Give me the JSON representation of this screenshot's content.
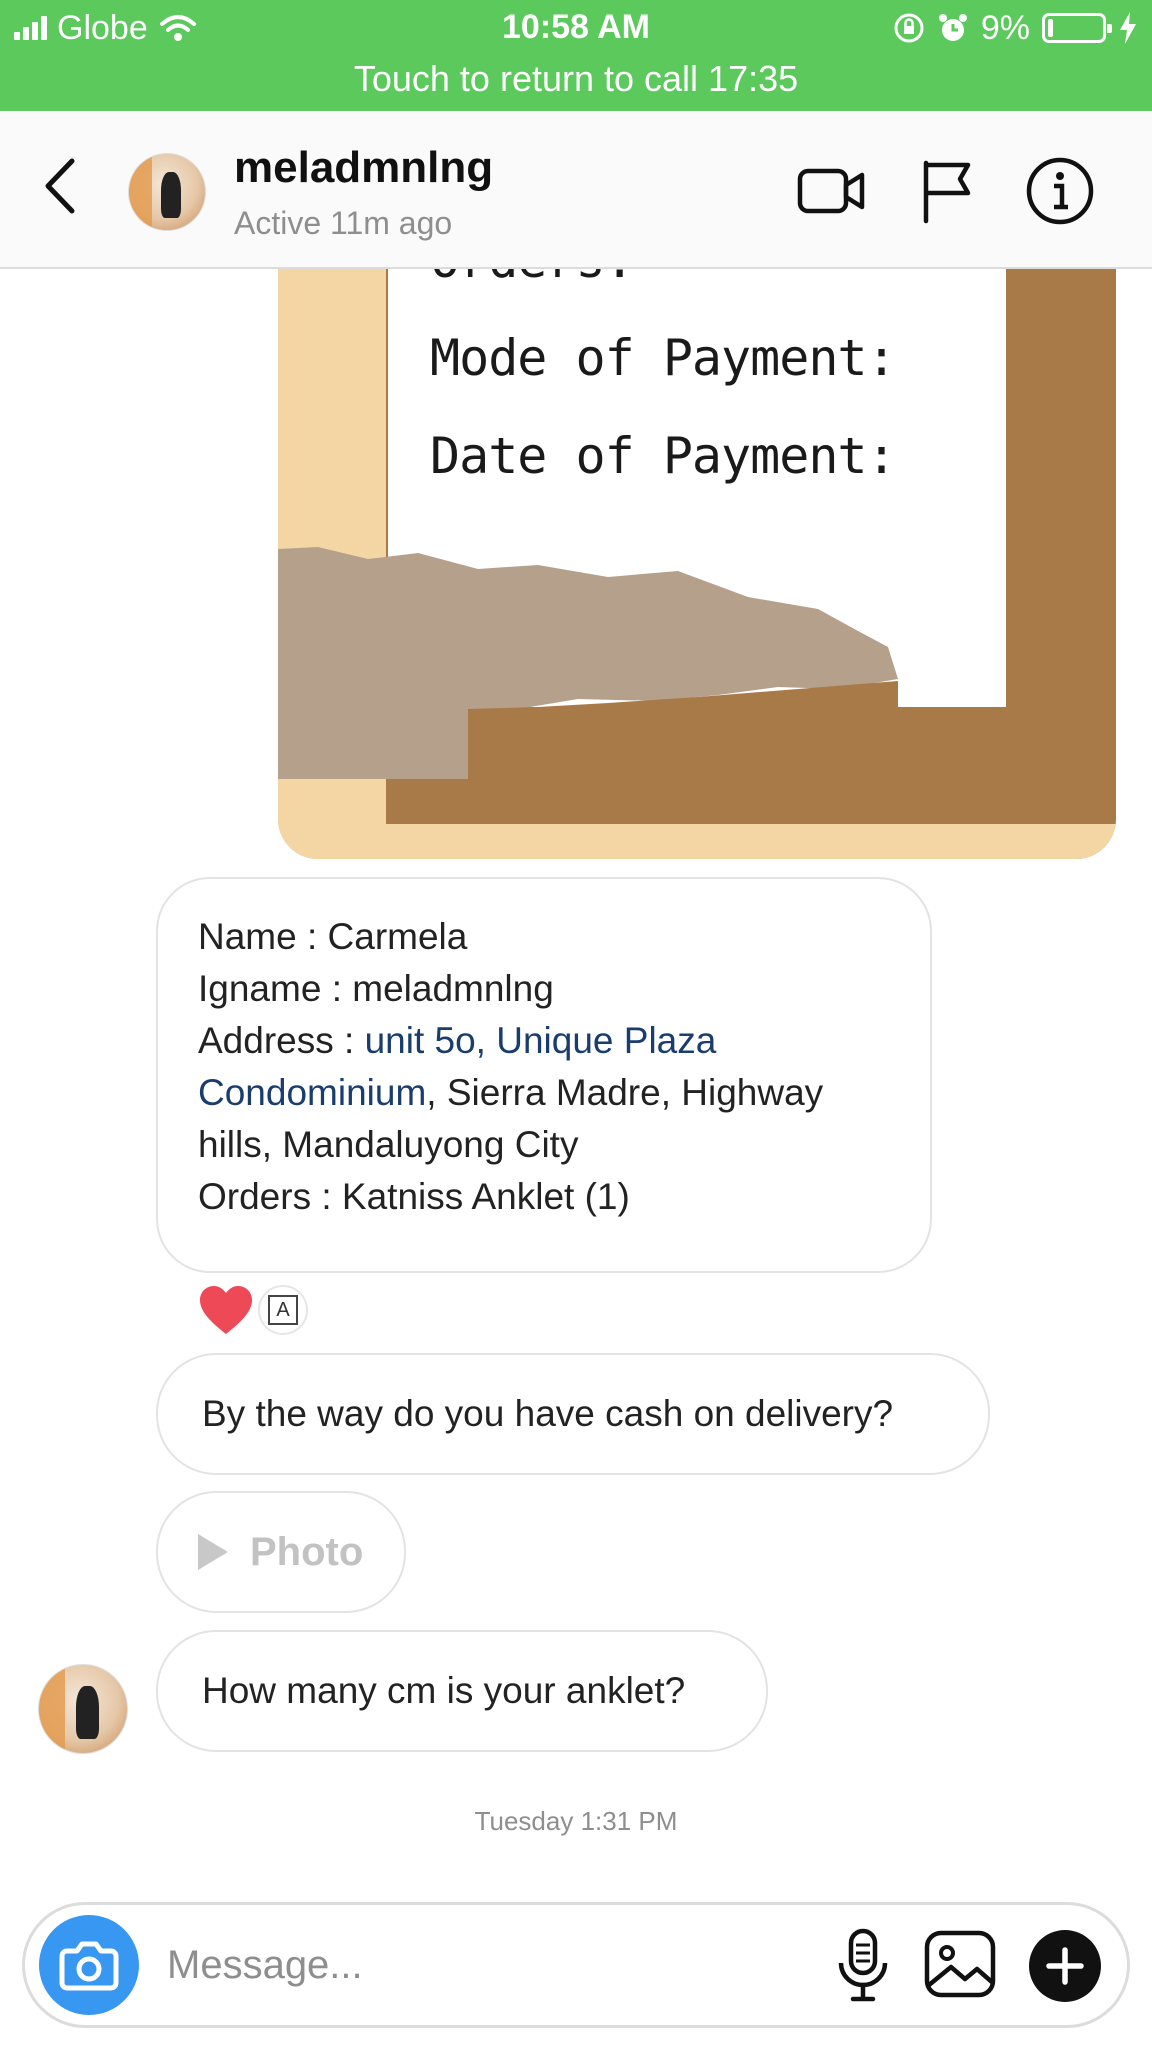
{
  "status_bar": {
    "carrier": "Globe",
    "time": "10:58 AM",
    "battery_percent": "9%",
    "battery_level": 0.09,
    "call_banner": "Touch to return to call 17:35"
  },
  "header": {
    "username": "meladmnlng",
    "activity": "Active 11m ago",
    "icons": [
      "back-chevron-icon",
      "video-call-icon",
      "flag-icon",
      "info-icon"
    ]
  },
  "shared_image": {
    "lines": [
      "Orders:",
      "Mode of Payment:",
      "Date of Payment:"
    ]
  },
  "order_message": {
    "name": "Name : Carmela",
    "igname": "Igname : meladmnlng",
    "address_prefix": "Address : ",
    "address_link": "unit 5o, Unique Plaza Condominium",
    "address_rest": ", Sierra Madre, Highway hills, Mandaluyong City",
    "orders": "Orders : Katniss Anklet (1)",
    "reactions": [
      "heart-icon",
      "seen-avatar-icon"
    ]
  },
  "messages": {
    "cod_question": "By the way do you have cash on delivery?",
    "photo_label": "Photo",
    "anklet_question": "How many cm is your anklet?"
  },
  "timestamp": "Tuesday 1:31 PM",
  "composer": {
    "placeholder": "Message...",
    "icons": [
      "camera-icon",
      "microphone-icon",
      "gallery-icon",
      "plus-icon"
    ]
  },
  "colors": {
    "status_bar_bg": "#5bc95c",
    "camera_button": "#3897f0",
    "link_text": "#1a3d6e",
    "heart": "#ed4956"
  }
}
